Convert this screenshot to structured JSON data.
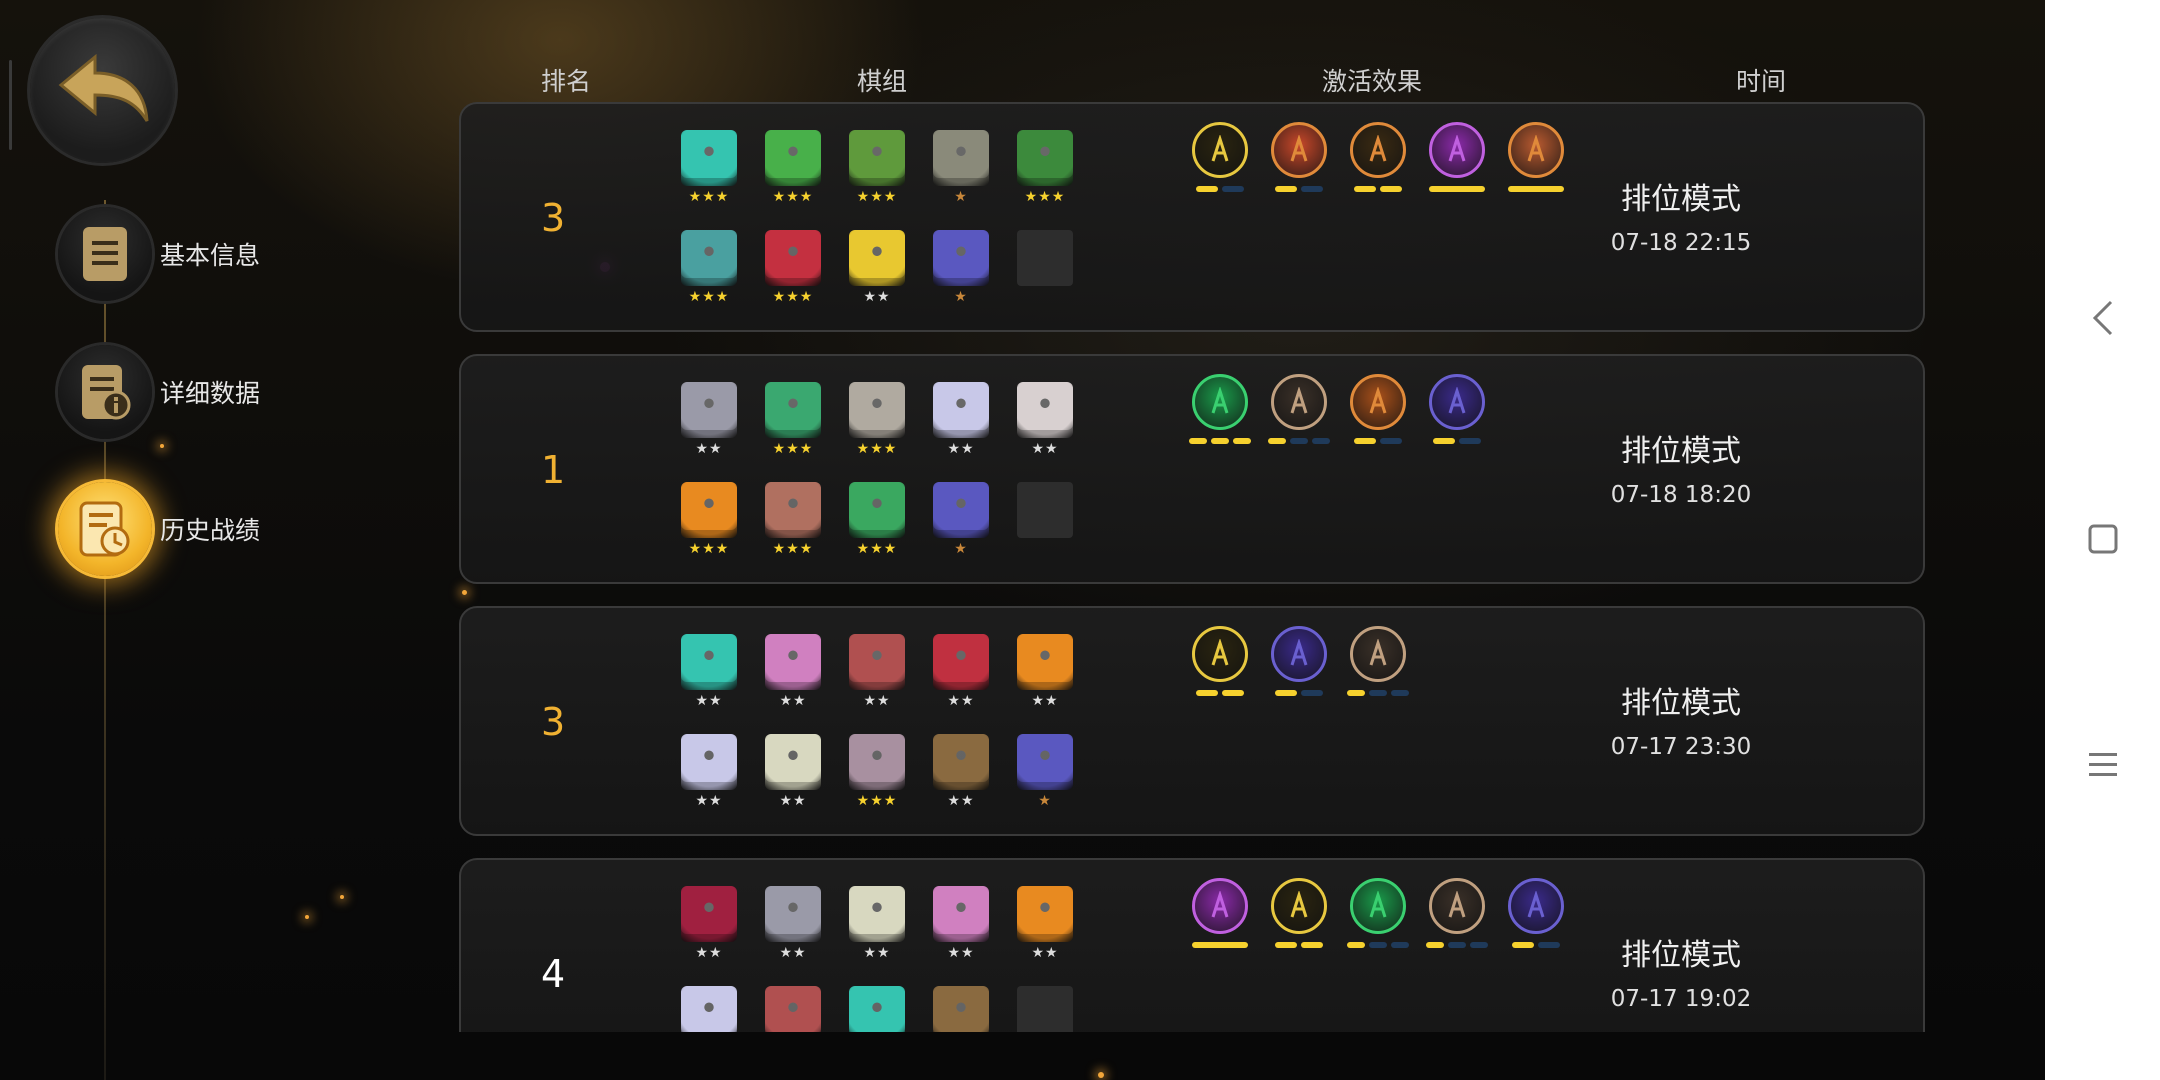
{
  "nav": {
    "back_icon": "back-arrow-icon",
    "items": [
      {
        "label": "基本信息",
        "icon": "document-icon"
      },
      {
        "label": "详细数据",
        "icon": "data-info-icon"
      },
      {
        "label": "历史战绩",
        "icon": "history-clock-icon"
      }
    ]
  },
  "columns": {
    "rank": "排名",
    "lineup": "棋组",
    "effects": "激活效果",
    "time": "时间"
  },
  "colors": {
    "accent_gold": "#f6d12e",
    "rank_gold": "#f0b132",
    "rank_white": "#ffffff",
    "bar_off": "#1f3a5a"
  },
  "matches": [
    {
      "rank": "3",
      "rank_color": "#f0b132",
      "heroes_row1": [
        {
          "color": "#35c4b0",
          "stars": "★★★",
          "star_color": "#f6d12e"
        },
        {
          "color": "#48b04a",
          "stars": "★★★",
          "star_color": "#f6d12e"
        },
        {
          "color": "#5f9a3c",
          "stars": "★★★",
          "star_color": "#f6d12e"
        },
        {
          "color": "#8a8a7a",
          "stars": "★",
          "star_color": "#c8873a"
        },
        {
          "color": "#3c8a3c",
          "stars": "★★★",
          "star_color": "#f6d12e"
        }
      ],
      "heroes_row2": [
        {
          "color": "#4aa0a0",
          "stars": "★★★",
          "star_color": "#f6d12e"
        },
        {
          "color": "#c43040",
          "stars": "★★★",
          "star_color": "#f6d12e"
        },
        {
          "color": "#e8c830",
          "stars": "★★",
          "star_color": "#dddddd"
        },
        {
          "color": "#5a58c0",
          "stars": "★",
          "star_color": "#c8873a"
        },
        null
      ],
      "effects": [
        {
          "icon": "claw-slash-icon",
          "bg": "#2a2410",
          "border": "#e7c840",
          "bars": [
            1,
            0
          ]
        },
        {
          "icon": "demon-face-icon",
          "bg": "#c8482a",
          "border": "#e08a3a",
          "bars": [
            1,
            0
          ]
        },
        {
          "icon": "gear-icon",
          "bg": "#3a2a12",
          "border": "#e08a3a",
          "bars": [
            1,
            1
          ]
        },
        {
          "icon": "purple-beast-icon",
          "bg": "#8a2aa8",
          "border": "#c060e0",
          "bars": [
            1
          ]
        },
        {
          "icon": "viking-helmet-icon",
          "bg": "#b85a30",
          "border": "#e08a3a",
          "bars": [
            1
          ]
        }
      ],
      "mode": "排位模式",
      "time": "07-18 22:15"
    },
    {
      "rank": "1",
      "rank_color": "#f0b132",
      "heroes_row1": [
        {
          "color": "#9a9aa8",
          "stars": "★★",
          "star_color": "#dddddd"
        },
        {
          "color": "#3aa870",
          "stars": "★★★",
          "star_color": "#f6d12e"
        },
        {
          "color": "#b0aaa0",
          "stars": "★★★",
          "star_color": "#f6d12e"
        },
        {
          "color": "#c8c8e8",
          "stars": "★★",
          "star_color": "#dddddd"
        },
        {
          "color": "#d8d0d0",
          "stars": "★★",
          "star_color": "#dddddd"
        }
      ],
      "heroes_row2": [
        {
          "color": "#e88a20",
          "stars": "★★★",
          "star_color": "#f6d12e"
        },
        {
          "color": "#b07060",
          "stars": "★★★",
          "star_color": "#f6d12e"
        },
        {
          "color": "#3aa860",
          "stars": "★★★",
          "star_color": "#f6d12e"
        },
        {
          "color": "#5a58c0",
          "stars": "★",
          "star_color": "#c8873a"
        },
        null
      ],
      "effects": [
        {
          "icon": "paw-icon",
          "bg": "#1a9a4a",
          "border": "#3ad070",
          "bars": [
            1,
            1,
            1
          ]
        },
        {
          "icon": "axe-icon",
          "bg": "#3a3028",
          "border": "#c0a080",
          "bars": [
            1,
            0,
            0
          ]
        },
        {
          "icon": "leaf-icon",
          "bg": "#a8501a",
          "border": "#e08a3a",
          "bars": [
            1,
            0
          ]
        },
        {
          "icon": "fishbone-icon",
          "bg": "#3a2a8a",
          "border": "#6a60d0",
          "bars": [
            1,
            0
          ]
        }
      ],
      "mode": "排位模式",
      "time": "07-18 18:20"
    },
    {
      "rank": "3",
      "rank_color": "#f0b132",
      "heroes_row1": [
        {
          "color": "#35c4b0",
          "stars": "★★",
          "star_color": "#dddddd"
        },
        {
          "color": "#d080c0",
          "stars": "★★",
          "star_color": "#dddddd"
        },
        {
          "color": "#b05050",
          "stars": "★★",
          "star_color": "#dddddd"
        },
        {
          "color": "#c03040",
          "stars": "★★",
          "star_color": "#dddddd"
        },
        {
          "color": "#e88a20",
          "stars": "★★",
          "star_color": "#dddddd"
        }
      ],
      "heroes_row2": [
        {
          "color": "#c8c8e8",
          "stars": "★★",
          "star_color": "#dddddd"
        },
        {
          "color": "#d8d8c0",
          "stars": "★★",
          "star_color": "#dddddd"
        },
        {
          "color": "#a890a0",
          "stars": "★★★",
          "star_color": "#f6d12e"
        },
        {
          "color": "#8a6a40",
          "stars": "★★",
          "star_color": "#dddddd"
        },
        {
          "color": "#5a58c0",
          "stars": "★",
          "star_color": "#c8873a"
        }
      ],
      "effects": [
        {
          "icon": "claw-slash-icon",
          "bg": "#2a2410",
          "border": "#e7c840",
          "bars": [
            1,
            1
          ]
        },
        {
          "icon": "fishbone-icon",
          "bg": "#3a2a8a",
          "border": "#6a60d0",
          "bars": [
            1,
            0
          ]
        },
        {
          "icon": "axe-icon",
          "bg": "#3a3028",
          "border": "#c0a080",
          "bars": [
            1,
            0,
            0
          ]
        }
      ],
      "mode": "排位模式",
      "time": "07-17 23:30"
    },
    {
      "rank": "4",
      "rank_color": "#ffffff",
      "heroes_row1": [
        {
          "color": "#a02040",
          "stars": "★★",
          "star_color": "#dddddd"
        },
        {
          "color": "#9a9aa8",
          "stars": "★★",
          "star_color": "#dddddd"
        },
        {
          "color": "#d8d8c0",
          "stars": "★★",
          "star_color": "#dddddd"
        },
        {
          "color": "#d080c0",
          "stars": "★★",
          "star_color": "#dddddd"
        },
        {
          "color": "#e88a20",
          "stars": "★★",
          "star_color": "#dddddd"
        }
      ],
      "heroes_row2": [
        {
          "color": "#c8c8e8",
          "stars": "",
          "star_color": "#dddddd"
        },
        {
          "color": "#b05050",
          "stars": "",
          "star_color": "#dddddd"
        },
        {
          "color": "#35c4b0",
          "stars": "",
          "star_color": "#dddddd"
        },
        {
          "color": "#8a6a40",
          "stars": "",
          "star_color": "#dddddd"
        },
        null
      ],
      "effects": [
        {
          "icon": "purple-beast-icon",
          "bg": "#8a2aa8",
          "border": "#c060e0",
          "bars": [
            1
          ]
        },
        {
          "icon": "claw-slash-icon",
          "bg": "#2a2410",
          "border": "#e7c840",
          "bars": [
            1,
            1
          ]
        },
        {
          "icon": "paw-icon",
          "bg": "#1a9a4a",
          "border": "#3ad070",
          "bars": [
            1,
            0,
            0
          ]
        },
        {
          "icon": "axe-icon",
          "bg": "#3a3028",
          "border": "#c0a080",
          "bars": [
            1,
            0,
            0
          ]
        },
        {
          "icon": "fishbone-icon",
          "bg": "#3a2a8a",
          "border": "#6a60d0",
          "bars": [
            1,
            0
          ]
        }
      ],
      "mode": "排位模式",
      "time": "07-17 19:02"
    }
  ],
  "system_nav": {
    "back_icon": "system-back-icon",
    "home_icon": "system-home-icon",
    "menu_icon": "system-menu-icon"
  }
}
